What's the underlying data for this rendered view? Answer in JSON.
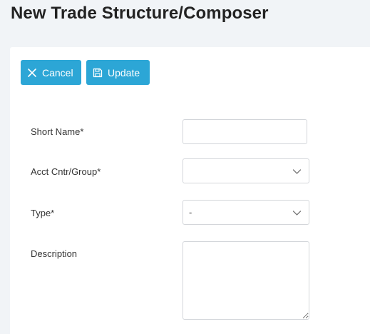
{
  "page": {
    "title": "New Trade Structure/Composer"
  },
  "toolbar": {
    "cancel_label": "Cancel",
    "cancel_icon": "close-icon",
    "update_label": "Update",
    "update_icon": "save-icon",
    "button_color": "#2ca6d6"
  },
  "form": {
    "short_name": {
      "label": "Short Name*",
      "value": "",
      "placeholder": ""
    },
    "acct_cntr_group": {
      "label": "Acct Cntr/Group*",
      "value": ""
    },
    "type": {
      "label": "Type*",
      "value": "-"
    },
    "description": {
      "label": "Description",
      "value": ""
    }
  }
}
